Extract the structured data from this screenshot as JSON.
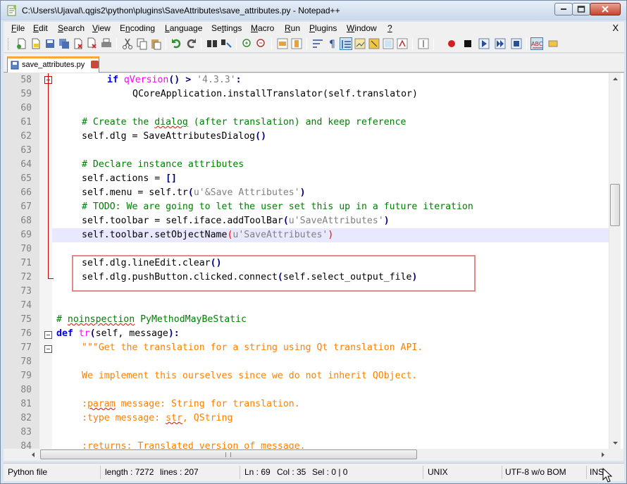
{
  "window": {
    "title": "C:\\Users\\Ujaval\\.qgis2\\python\\plugins\\SaveAttributes\\save_attributes.py - Notepad++"
  },
  "menu": [
    {
      "label": "File",
      "accel": "F",
      "rest": "ile"
    },
    {
      "label": "Edit",
      "accel": "E",
      "rest": "dit"
    },
    {
      "label": "Search",
      "accel": "S",
      "rest": "earch"
    },
    {
      "label": "View",
      "accel": "V",
      "rest": "iew"
    },
    {
      "label": "Encoding",
      "accel": "n",
      "pre": "E",
      "rest": "coding"
    },
    {
      "label": "Language",
      "accel": "L",
      "rest": "anguage"
    },
    {
      "label": "Settings",
      "accel": "t",
      "pre": "Se",
      "rest": "tings"
    },
    {
      "label": "Macro",
      "accel": "M",
      "rest": "acro"
    },
    {
      "label": "Run",
      "accel": "R",
      "rest": "un"
    },
    {
      "label": "Plugins",
      "accel": "P",
      "rest": "lugins"
    },
    {
      "label": "Window",
      "accel": "W",
      "rest": "indow"
    },
    {
      "label": "?",
      "accel": "?",
      "rest": ""
    }
  ],
  "menu_close": "X",
  "tab": {
    "label": "save_attributes.py"
  },
  "editor": {
    "current_line": 69,
    "lines": [
      {
        "n": "58"
      },
      {
        "n": "59"
      },
      {
        "n": "60"
      },
      {
        "n": "61"
      },
      {
        "n": "62"
      },
      {
        "n": "63"
      },
      {
        "n": "64"
      },
      {
        "n": "65"
      },
      {
        "n": "66"
      },
      {
        "n": "67"
      },
      {
        "n": "68"
      },
      {
        "n": "69"
      },
      {
        "n": "70"
      },
      {
        "n": "71"
      },
      {
        "n": "72"
      },
      {
        "n": "73"
      },
      {
        "n": "74"
      },
      {
        "n": "75"
      },
      {
        "n": "76"
      },
      {
        "n": "77"
      },
      {
        "n": "78"
      },
      {
        "n": "79"
      },
      {
        "n": "80"
      },
      {
        "n": "81"
      },
      {
        "n": "82"
      },
      {
        "n": "83"
      },
      {
        "n": "84"
      }
    ],
    "code": {
      "l58": [
        "if",
        " qVersion",
        "()",
        " > ",
        "'4.3.3'",
        ":"
      ],
      "l59": "QCoreApplication.installTranslator(self.translator)",
      "l61": [
        "# Create the ",
        "dialog",
        " (after translation) and keep reference"
      ],
      "l62": [
        "self.dlg = SaveAttributesDialog",
        "()"
      ],
      "l64": "# Declare instance attributes",
      "l65": [
        "self.actions = ",
        "[]"
      ],
      "l66": [
        "self.menu = self.tr",
        "(",
        "u'&Save Attributes'",
        ")"
      ],
      "l67": "# TODO: We are going to let the user set this up in a future iteration",
      "l68": [
        "self.toolbar = self.iface.addToolBar",
        "(",
        "u'SaveAttributes'",
        ")"
      ],
      "l69": [
        "self.toolbar.setObjectName",
        "(",
        "u'SaveAttributes'",
        ")"
      ],
      "l71": [
        "self.dlg.lineEdit.clear",
        "()"
      ],
      "l72": [
        "self.dlg.pushButton.clicked.connect",
        "(",
        "self.select_output_file",
        ")"
      ],
      "l75": [
        "# ",
        "noinspection",
        " PyMethodMayBeStatic"
      ],
      "l76": [
        "def",
        " ",
        "tr",
        "(",
        "self, message",
        "):"
      ],
      "l77": "\"\"\"Get the translation for a string using Qt translation API.",
      "l79": "We implement this ourselves since we do not inherit QObject.",
      "l81": [
        ":",
        "param",
        " message: String for translation."
      ],
      "l82": [
        ":type message: ",
        "str",
        ", QString"
      ],
      "l84": ":returns: Translated version of message."
    }
  },
  "statusbar": {
    "filetype": "Python file",
    "length": "length : 7272",
    "lines": "lines : 207",
    "ln": "Ln : 69",
    "col": "Col : 35",
    "sel": "Sel : 0 | 0",
    "eol": "UNIX",
    "encoding": "UTF-8 w/o BOM",
    "mode": "INS"
  },
  "colors": {
    "keyword": "#0000ff",
    "comment": "#008000",
    "string": "#808080",
    "docstring": "#ff8000",
    "function": "#ff00ff",
    "current_line_bg": "#e8e8ff",
    "annotation_box": "#e08a8a"
  }
}
